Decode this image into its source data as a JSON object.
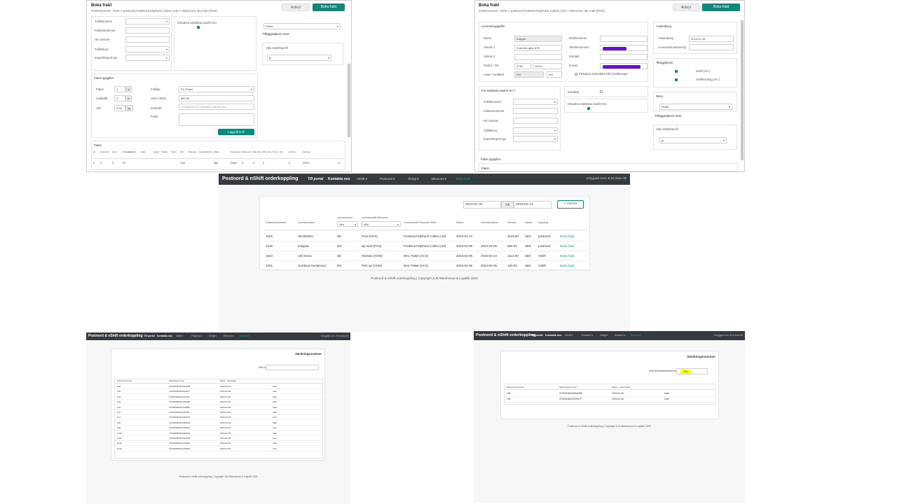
{
  "top_left": {
    "title": "Boka frakt",
    "subtitle": "Ordernummer: 1016 > postnord PostNord MyPack Collect (19) > eEkonom: By mail (POS)",
    "avbryt": "Avbryt",
    "boka": "Boka frakt",
    "customs_labels": [
      "Tulldokument",
      "Fakturanummer",
      "Hit nummer",
      "Tullfaktura",
      "Import/Export typ"
    ],
    "inkludera": "Inkludera särskilda utanför EU",
    "oleveransval": "Direkt",
    "tillaggstjanst_retur": "Tilläggstjänst retur",
    "valj_utskriftsprofil": "Välj utskriftsprofil",
    "profil": "jp",
    "paket_uppgifter": "Paket uppgifter",
    "pkg_labels": [
      "Paket",
      "Lastpalle",
      "Vikt",
      "Kollityp",
      "Varor (SEK)",
      "Innehåll",
      "Fraktr"
    ],
    "pkg_vals": [
      "1",
      "0",
      "3.00"
    ],
    "units": [
      "st",
      "st",
      "kg"
    ],
    "kollityp": "PC-Paket",
    "varor_sek": "560.00",
    "innehall_ph": "<Ongatortol för särskilda utanför EU>",
    "lagg_till": "Lägg till kolli",
    "paket": "Paket",
    "table_headers": [
      "Nr",
      "Antal kolli",
      "Antal",
      "Paketkod",
      "Innehåll",
      "Höjd",
      "Längd",
      "Bredd",
      "Volym",
      "Vikt",
      "Palmeter",
      "Godsmärkning",
      "Värde",
      "Temperatur",
      "Ideal temp",
      "Max temp",
      "Min temp",
      "ID typ",
      "Text",
      "Antal st",
      "Ident typ"
    ],
    "table_row": [
      "1",
      "1",
      "0",
      "PC",
      "",
      "",
      "",
      "",
      "",
      "3.00",
      "",
      "",
      "560",
      "Fales",
      "0",
      "0",
      "0",
      "",
      "",
      "0",
      "SSCC"
    ]
  },
  "top_right": {
    "title": "Boka frakt",
    "subtitle": "Ordernummer: 1016 > postnord PostNord MyPack Collect (19) > eEkonom: By mail (POS)",
    "avbryt": "Avbryt",
    "boka": "Boka frakt",
    "leveransuppgifter": "Leveransuppgifter",
    "addr_labels": [
      "Namn",
      "Adress 1",
      "Adress 2",
      "Postnr / Ort",
      "Land / Landkod"
    ],
    "addr_vals": [
      "Insigna",
      "Kommes gata 67B",
      "",
      "0786",
      "OSLO",
      "NO",
      "NO"
    ],
    "contact_labels": [
      "Mobilnummer",
      "Telefonnummer",
      "Kontakt",
      "E-post"
    ],
    "inkludera_mobil": "Inkludera sekundära från inställningar",
    "avsandning": "Avsändning",
    "avsandning_labels": [
      "Avsändning",
      "Leveranssnummering"
    ],
    "datum": "2023-02-15",
    "tillaggstjanst": "Tilläggstjänst",
    "services": [
      "Notifi (AU )",
      "Verifiktioning (AV )"
    ],
    "retur": "Retur",
    "retur_val": "Direkt",
    "tillaggstjanst_retur": "Tilläggstjänst retur",
    "valj_utskriftsprofil": "Välj utskriftsprofil",
    "profil": "jp",
    "for_sarskilda": "För särskilda utanför EU ?",
    "customs_labels": [
      "Tulldokument",
      "Fakturanummer",
      "Hit nummer",
      "Tullfaktura",
      "Import/Export typ"
    ],
    "kavallde": "Kavallde",
    "inkludera": "Inkludera särskilda utanför EU",
    "paket_uppgifter": "Paket uppgifter",
    "paket": "Paket"
  },
  "middle": {
    "brand": "Postnord & nShift orderkoppling",
    "nav": [
      "Till portal",
      "Kontakta oss",
      "nShift ▾",
      "Postnord ▾",
      "Övrigt ▾",
      "Ekonomi ▾",
      "Boka frakt"
    ],
    "logged_in": "Inloggad som JLM data AB",
    "date_from": "2023-01-30",
    "till": "Till",
    "date_to": "2023-02-14",
    "search_btn": "Hämta",
    "headers": [
      "Dokumentnummer",
      "Leveransnamn",
      "Leveransland",
      "Leveranssätt eEkonomi",
      "Leveranssätt Postnord nShift",
      "Datum",
      "Leveransdatum",
      "Summa",
      "Valuta",
      "Koppling"
    ],
    "filter_vals": [
      "Alla",
      "Alla"
    ],
    "rows": [
      [
        "1025",
        "Skollöslärn",
        "SE",
        "Post (POS)",
        "PostNord MyPack Collect (19)",
        "2023-02-13",
        "",
        "3119.00",
        "SEK",
        "postnord",
        "Boka frakt"
      ],
      [
        "1016",
        "Insignia",
        "NO",
        "By mail (POS)",
        "PostNord MyPack Collect (19)",
        "2023-02-06",
        "2023-02-06",
        "560.00",
        "SEK",
        "postnord",
        "Boka frakt"
      ],
      [
        "1023",
        "LM Vision",
        "SE",
        "Hämtas (HÄM)",
        "DHL Paket (ACX)",
        "2023-02-06",
        "2023-02-24",
        "1113.00",
        "SEK",
        "nshift",
        "Boka frakt"
      ],
      [
        "1021",
        "Gordana Snelanovic",
        "RS",
        "Pick up (HÄM)",
        "DHL Paket (ACX)",
        "2023-02-06",
        "2023-02-26",
        "100.00",
        "SEK",
        "nshift",
        "Boka frakt"
      ]
    ],
    "footer": "Postnord & nShift orderkoppling | Copyright JLM Warehouse & Logistik 2023"
  },
  "bottom_left": {
    "brand": "Postnord & nShift orderkoppling",
    "nav": [
      "Till portal",
      "Kontakta oss",
      "nShift ▾",
      "Postnord ▾",
      "Övrigt ▾",
      "Ekonomi ▾",
      "Boka frakt"
    ],
    "logged_in": "Inloggad som JLM data AB",
    "sandningsnummer": "Sändningsnummer",
    "sok_label": "Sök dokumentnummer",
    "headers": [
      "Dokumentnummer",
      "Sändningsnummer",
      "Datum - Gett bokad",
      ""
    ],
    "rows": [
      [
        "106",
        "373325384025544358",
        "2023-02-06",
        "frakt"
      ],
      [
        "106",
        "373325384022091077",
        "2023-02-06",
        "retur"
      ],
      [
        "106",
        "373325384021191159",
        "2023-02-06",
        "frakt"
      ],
      [
        "106",
        "373325384021362380",
        "2023-02-06",
        "frakt"
      ],
      [
        "106",
        "373325384021518860",
        "2023-02-06",
        "frakt"
      ],
      [
        "107",
        "373325384021187909",
        "2023-02-06",
        "frakt"
      ],
      [
        "107",
        "373325384021362370",
        "2023-02-06",
        "retur"
      ],
      [
        "108",
        "373325384021460923",
        "2023-02-06",
        "frakt"
      ],
      [
        "108",
        "373325384021406640",
        "2023-02-06",
        "retur"
      ],
      [
        "1016",
        "373325384021920326",
        "2023-02-06",
        "frakt"
      ],
      [
        "1020",
        "373325384021923352",
        "2023-02-06",
        "retur"
      ],
      [
        "1010",
        "373325384021245922",
        "2023-02-03",
        "frakt"
      ],
      [
        "1016",
        "373325384021252890",
        "2023-02-03",
        "retur"
      ]
    ],
    "footer": "Postnord & nShift orderkoppling | Copyright JLM Warehouse & Logistik 2023"
  },
  "bottom_right": {
    "brand": "Postnord & nShift orderkoppling",
    "nav": [
      "Till portal",
      "Kontakta oss",
      "nShift ▾",
      "Postnord ▾",
      "Övrigt ▾",
      "Ekonomi ▾",
      "Boka frakt"
    ],
    "logged_in": "Inloggad som JLM data AB",
    "sandningsnummer": "Sändningsnummer",
    "sok_label": "Sök dokumentnummer",
    "sok_val": "106",
    "headers": [
      "Dokumentnummer",
      "Sändningsnummer",
      "Datum - Gett bokad",
      ""
    ],
    "rows": [
      [
        "106",
        "373325384025544358",
        "2023-02-06",
        "frakt"
      ],
      [
        "106",
        "373325384022091077",
        "2023-02-06",
        "retur"
      ]
    ],
    "footer": "Postnord & nShift orderkoppling | Copyright JLM Warehouse & Logistik 2023"
  },
  "colors": {
    "teal": "#0a8a7d",
    "navbar": "#343a40",
    "purple": "#6a0dcc",
    "yellow": "#ffff00",
    "link": "#17a589"
  }
}
